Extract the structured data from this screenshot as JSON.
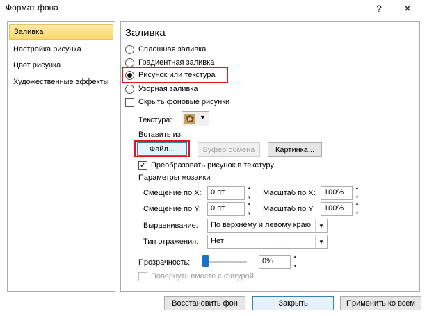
{
  "window": {
    "title": "Формат фона",
    "help": "?",
    "close": "✕"
  },
  "nav": {
    "items": [
      {
        "label": "Заливка"
      },
      {
        "label": "Настройка рисунка"
      },
      {
        "label": "Цвет рисунка"
      },
      {
        "label": "Художественные эффекты"
      }
    ],
    "selected_index": 0
  },
  "fill": {
    "title": "Заливка",
    "options": [
      {
        "label": "Сплошная заливка",
        "selected": false
      },
      {
        "label": "Градиентная заливка",
        "selected": false
      },
      {
        "label": "Рисунок или текстура",
        "selected": true
      },
      {
        "label": "Узорная заливка",
        "selected": false
      }
    ],
    "hide_bg": {
      "label": "Скрыть фоновые рисунки",
      "checked": false
    },
    "texture_label": "Текстура:",
    "insert_from_label": "Вставить из:",
    "buttons": {
      "file": "Файл...",
      "clipboard": "Буфер обмена",
      "clipart": "Картинка..."
    },
    "tile": {
      "label": "Преобразовать рисунок в текстуру",
      "checked": true
    },
    "tiling": {
      "title": "Параметры мозаики",
      "offset_x": {
        "label": "Смещение по X:",
        "value": "0 пт"
      },
      "offset_y": {
        "label": "Смещение по Y:",
        "value": "0 пт"
      },
      "scale_x": {
        "label": "Масштаб по X:",
        "value": "100%"
      },
      "scale_y": {
        "label": "Масштаб по Y:",
        "value": "100%"
      },
      "alignment": {
        "label": "Выравнивание:",
        "value": "По верхнему и левому краю"
      },
      "mirror": {
        "label": "Тип отражения:",
        "value": "Нет"
      }
    },
    "transparency": {
      "label": "Прозрачность:",
      "value": "0%",
      "level": 0
    },
    "rotate_with_shape": {
      "label": "Повернуть вместе с фигурой",
      "checked": false
    }
  },
  "footer": {
    "reset": "Восстановить фон",
    "close": "Закрыть",
    "apply_all": "Применить ко всем"
  },
  "colors": {
    "selection_bg": "#fcd96c",
    "highlight": "#e3141d",
    "accent": "#3c7fb1"
  }
}
